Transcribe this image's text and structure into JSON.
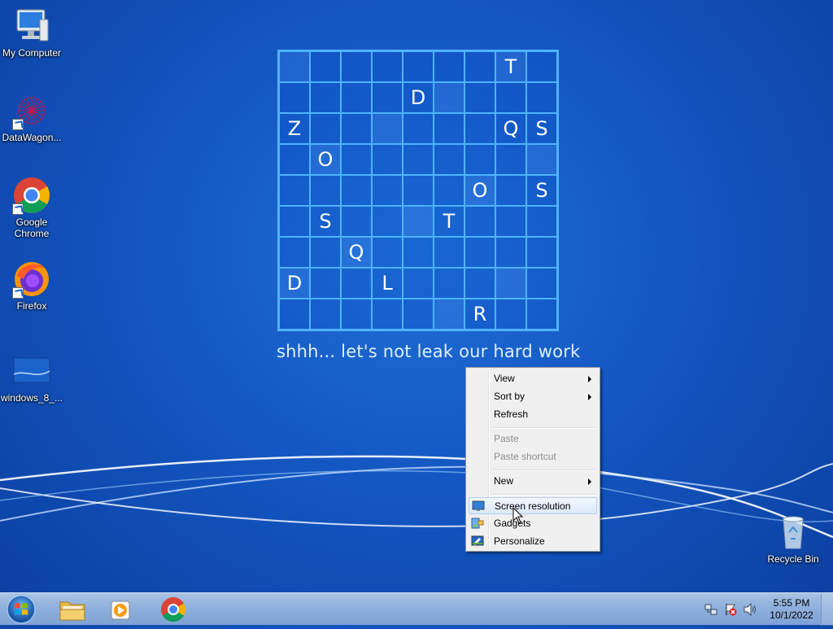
{
  "desktop": {
    "icons": [
      {
        "label": "My Computer",
        "icon": "computer-icon"
      },
      {
        "label": "DataWagon...",
        "icon": "datawagon-icon"
      },
      {
        "label": "Google Chrome",
        "label_line1": "Google",
        "label_line2": "Chrome",
        "icon": "chrome-icon"
      },
      {
        "label": "Firefox",
        "icon": "firefox-icon"
      },
      {
        "label": "windows_8_...",
        "icon": "wallpaper-file-icon"
      },
      {
        "label": "Recycle Bin",
        "icon": "recycle-bin-icon"
      }
    ],
    "wallpaper": {
      "grid": [
        [
          "",
          "",
          "",
          "",
          "",
          "",
          "",
          "T",
          ""
        ],
        [
          "",
          "",
          "",
          "",
          "D",
          "",
          "",
          "",
          ""
        ],
        [
          "Z",
          "",
          "",
          "",
          "",
          "",
          "",
          "Q",
          "S"
        ],
        [
          "",
          "O",
          "",
          "",
          "",
          "",
          "",
          "",
          ""
        ],
        [
          "",
          "",
          "",
          "",
          "",
          "",
          "O",
          "",
          "S"
        ],
        [
          "",
          "S",
          "",
          "",
          "",
          "T",
          "",
          "",
          ""
        ],
        [
          "",
          "",
          "Q",
          "",
          "",
          "",
          "",
          "",
          ""
        ],
        [
          "D",
          "",
          "",
          "L",
          "",
          "",
          "",
          "",
          ""
        ],
        [
          "",
          "",
          "",
          "",
          "",
          "",
          "R",
          "",
          ""
        ]
      ],
      "tagline": "shhh... let's not leak our hard work"
    }
  },
  "context_menu": {
    "items": [
      {
        "label": "View",
        "submenu": true,
        "enabled": true
      },
      {
        "label": "Sort by",
        "submenu": true,
        "enabled": true
      },
      {
        "label": "Refresh",
        "submenu": false,
        "enabled": true
      },
      {
        "label": "Paste",
        "submenu": false,
        "enabled": false
      },
      {
        "label": "Paste shortcut",
        "submenu": false,
        "enabled": false
      },
      {
        "label": "New",
        "submenu": true,
        "enabled": true
      },
      {
        "label": "Screen resolution",
        "submenu": false,
        "enabled": true,
        "highlighted": true,
        "icon": "screen-resolution-icon"
      },
      {
        "label": "Gadgets",
        "submenu": false,
        "enabled": true,
        "icon": "gadgets-icon"
      },
      {
        "label": "Personalize",
        "submenu": false,
        "enabled": true,
        "icon": "personalize-icon"
      }
    ]
  },
  "taskbar": {
    "start_icon": "windows-start-icon",
    "pinned": [
      "file-explorer-icon",
      "media-player-icon",
      "chrome-icon"
    ],
    "tray_icons": [
      "network-icon",
      "action-center-icon",
      "volume-icon"
    ],
    "clock": {
      "time": "5:55 PM",
      "date": "10/1/2022"
    }
  },
  "colors": {
    "desktop_bg": "#1456c2",
    "grid_line": "#4fb3ff",
    "menu_bg": "#f0f0f0",
    "menu_highlight": "#dbe9fb",
    "taskbar": "#8fb0dc"
  }
}
